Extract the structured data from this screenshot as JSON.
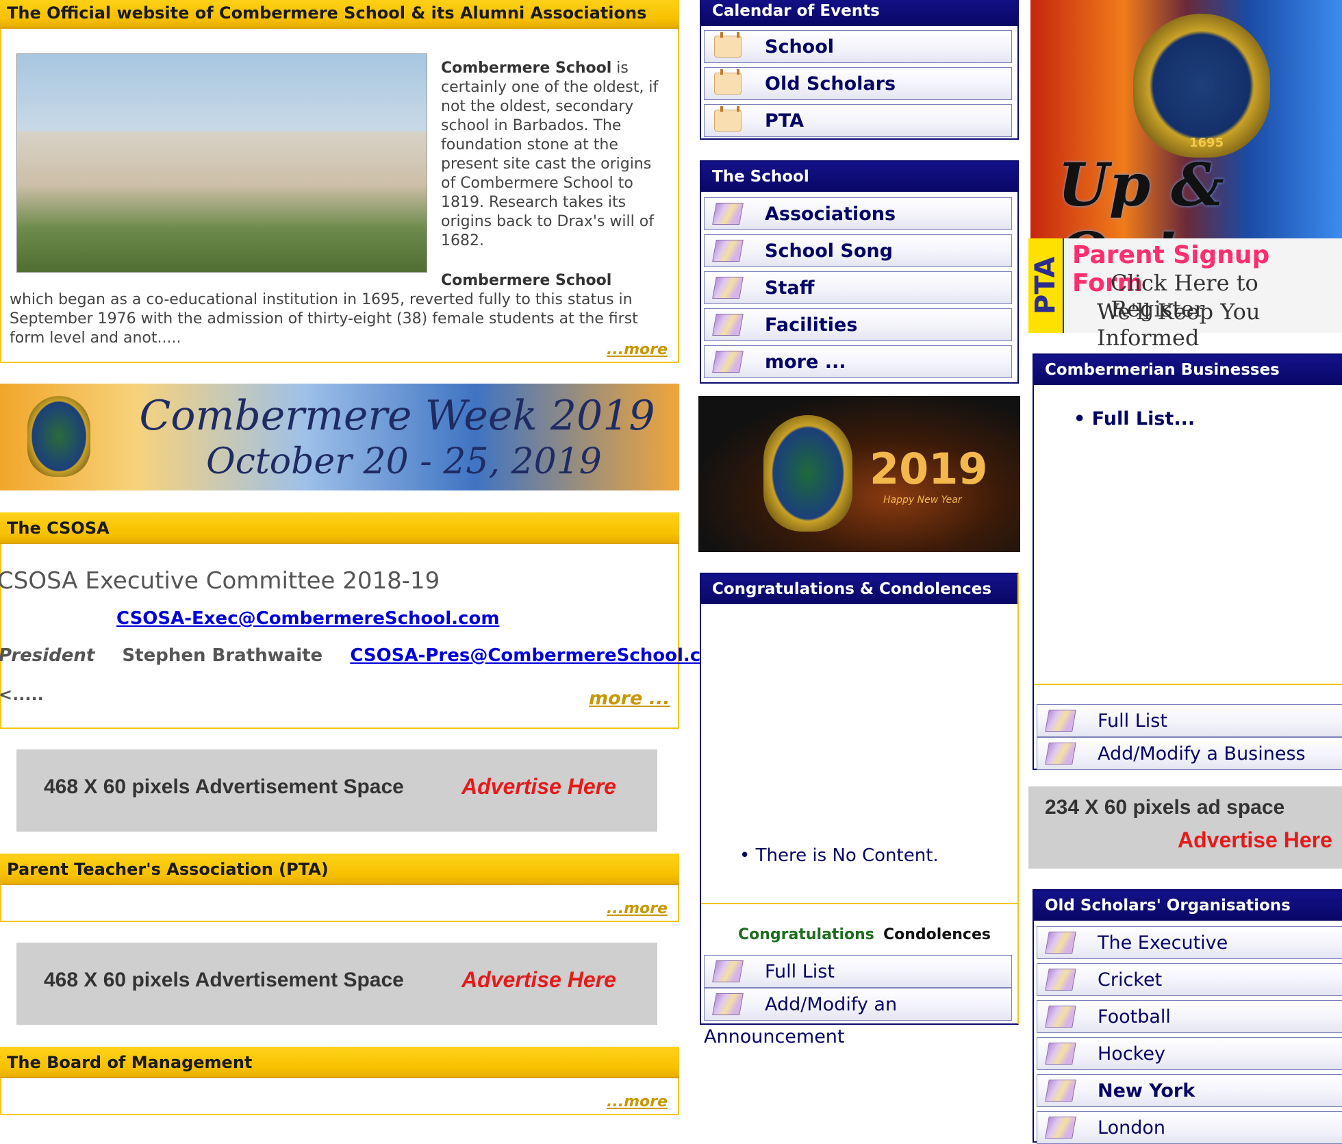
{
  "top_header": {
    "title": "The Official website of Combermere School & its Alumni Associations"
  },
  "intro": {
    "para1_bold": "Combermere School",
    "para1_rest": " is certainly one of the oldest, if not the oldest, secondary school in Barbados. The foundation stone at the present site cast the origins of Combermere School to 1819. Research takes its origins back to Drax's will of 1682.",
    "para2_bold": "Combermere School",
    "para2_rest": " which began as a co-educational institution in 1695, reverted fully to this status in September 1976 with the admission of thirty-eight (38) female students at the first form level and anot.....",
    "more": "...more"
  },
  "week_banner": {
    "line1": "Combermere Week 2019",
    "line2": "October 20 - 25, 2019"
  },
  "csosa": {
    "header": "The CSOSA",
    "title": "CSOSA Executive Committee 2018-19",
    "exec_email": "CSOSA-Exec@CombermereSchool.com",
    "role": "President",
    "president": "Stephen Brathwaite",
    "pres_email": "CSOSA-Pres@CombermereSchool.com",
    "trail": "<.....",
    "more": "more ..."
  },
  "ad1": {
    "text": "468 X 60 pixels Advertisement Space",
    "cta": "Advertise Here"
  },
  "pta": {
    "header": "Parent Teacher's Association (PTA)",
    "more": "...more"
  },
  "ad2": {
    "text": "468 X 60 pixels Advertisement Space",
    "cta": "Advertise Here"
  },
  "board": {
    "header": "The Board of Management",
    "more": "...more"
  },
  "calendar": {
    "header": "Calendar of Events",
    "items": [
      {
        "label": "School",
        "icon": "calendar-icon"
      },
      {
        "label": "Old Scholars",
        "icon": "calendar-icon"
      },
      {
        "label": "PTA",
        "icon": "calendar-icon"
      }
    ]
  },
  "school": {
    "header": "The School",
    "items": [
      {
        "label": "Associations",
        "icon": "book-icon"
      },
      {
        "label": "School Song",
        "icon": "book-icon"
      },
      {
        "label": "Staff",
        "icon": "book-icon"
      },
      {
        "label": "Facilities",
        "icon": "book-icon"
      },
      {
        "label": "more ...",
        "icon": "book-icon"
      }
    ]
  },
  "ny_banner": {
    "year": "2019",
    "tag": "Happy New Year"
  },
  "congrats": {
    "header": "Congratulations & Condolences",
    "empty": "There is No Content.",
    "tab_congrats": "Congratulations",
    "tab_condolences": "Condolences",
    "items": [
      {
        "label": "Full List",
        "icon": "book-icon"
      },
      {
        "label": "Add/Modify an",
        "icon": "book-icon"
      }
    ],
    "overflow": "Announcement"
  },
  "upon_banner": {
    "motto": "Up & On!",
    "est": "1695"
  },
  "pta_signup": {
    "side": "PTA",
    "title": "Parent Signup Form",
    "line1": "Click Here to Register",
    "line2": "We'll Keep You Informed"
  },
  "businesses": {
    "header": "Combermerian Businesses",
    "bullet": "Full List...",
    "items": [
      {
        "label": "Full List",
        "icon": "book-icon"
      },
      {
        "label": "Add/Modify a Business",
        "icon": "book-icon"
      }
    ]
  },
  "ad3": {
    "text": "234 X 60 pixels ad space",
    "cta": "Advertise Here"
  },
  "organisations": {
    "header": "Old Scholars' Organisations",
    "items": [
      {
        "label": "The Executive",
        "icon": "book-icon"
      },
      {
        "label": "Cricket",
        "icon": "book-icon"
      },
      {
        "label": "Football",
        "icon": "book-icon"
      },
      {
        "label": "Hockey",
        "icon": "book-icon"
      },
      {
        "label": "New York",
        "icon": "book-icon"
      },
      {
        "label": "London",
        "icon": "book-icon"
      }
    ]
  }
}
